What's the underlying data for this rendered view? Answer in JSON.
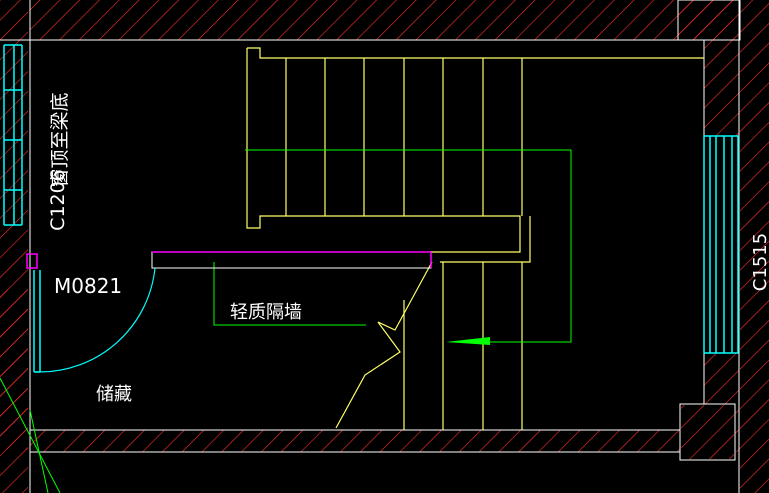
{
  "drawing": {
    "labels": {
      "window_note": "窗顶至梁底",
      "window_code_left": "C1206",
      "door_code": "M0821",
      "partition_note": "轻质隔墙",
      "room_name": "储藏",
      "window_code_right": "C1515"
    },
    "colors": {
      "wall_hatch": "#ff3030",
      "wall_outline": "#ffffff",
      "stair": "#ffff66",
      "leader": "#00ff00",
      "window": "#00ffff",
      "door_frame": "#ff00ff",
      "text": "#ffffff"
    }
  }
}
